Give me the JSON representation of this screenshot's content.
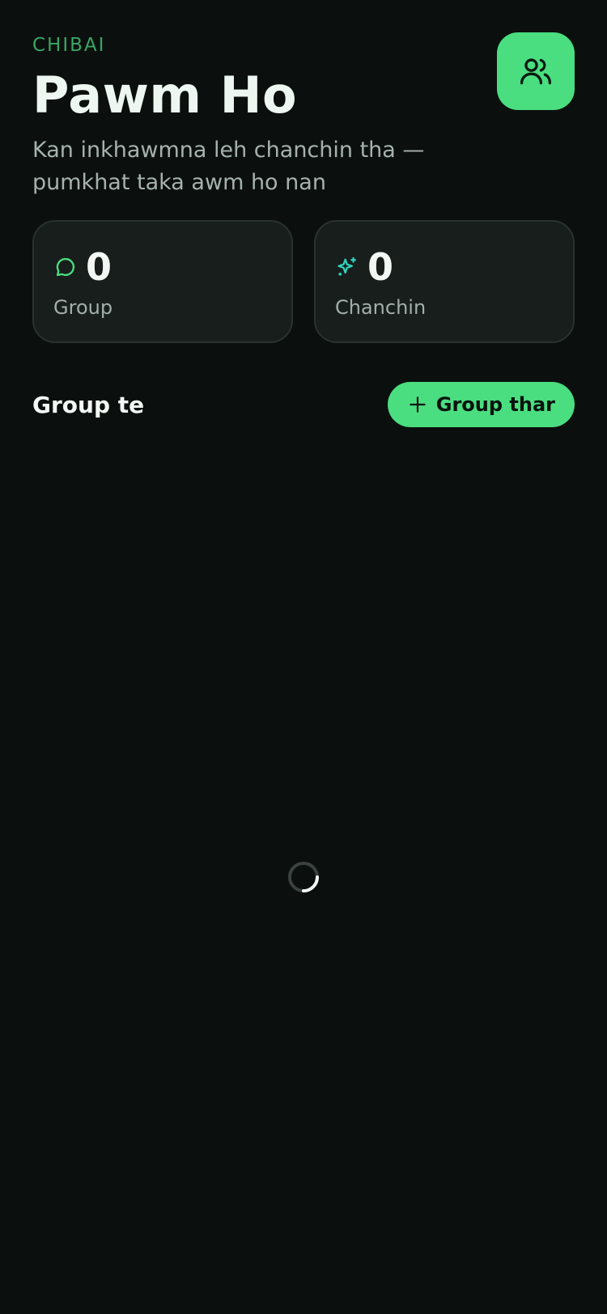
{
  "header": {
    "kicker": "CHIBAI",
    "title": "Pawm Ho",
    "subtitle": "Kan inkhawmna leh chanchin tha — pumkhat taka awm ho nan"
  },
  "profile_button": {
    "icon": "users-icon"
  },
  "stats": [
    {
      "icon": "chat-bubble-icon",
      "value": "0",
      "label": "Group",
      "icon_color": "#4ade80"
    },
    {
      "icon": "sparkle-icon",
      "value": "0",
      "label": "Chanchin",
      "icon_color": "#2dd4bf"
    }
  ],
  "section": {
    "title": "Group te",
    "add_button_label": "Group thar",
    "add_button_icon": "plus-icon"
  },
  "loading": {
    "icon": "spinner-icon"
  },
  "colors": {
    "background": "#0b100e",
    "accent": "#4ade80",
    "card": "#171e1c"
  }
}
